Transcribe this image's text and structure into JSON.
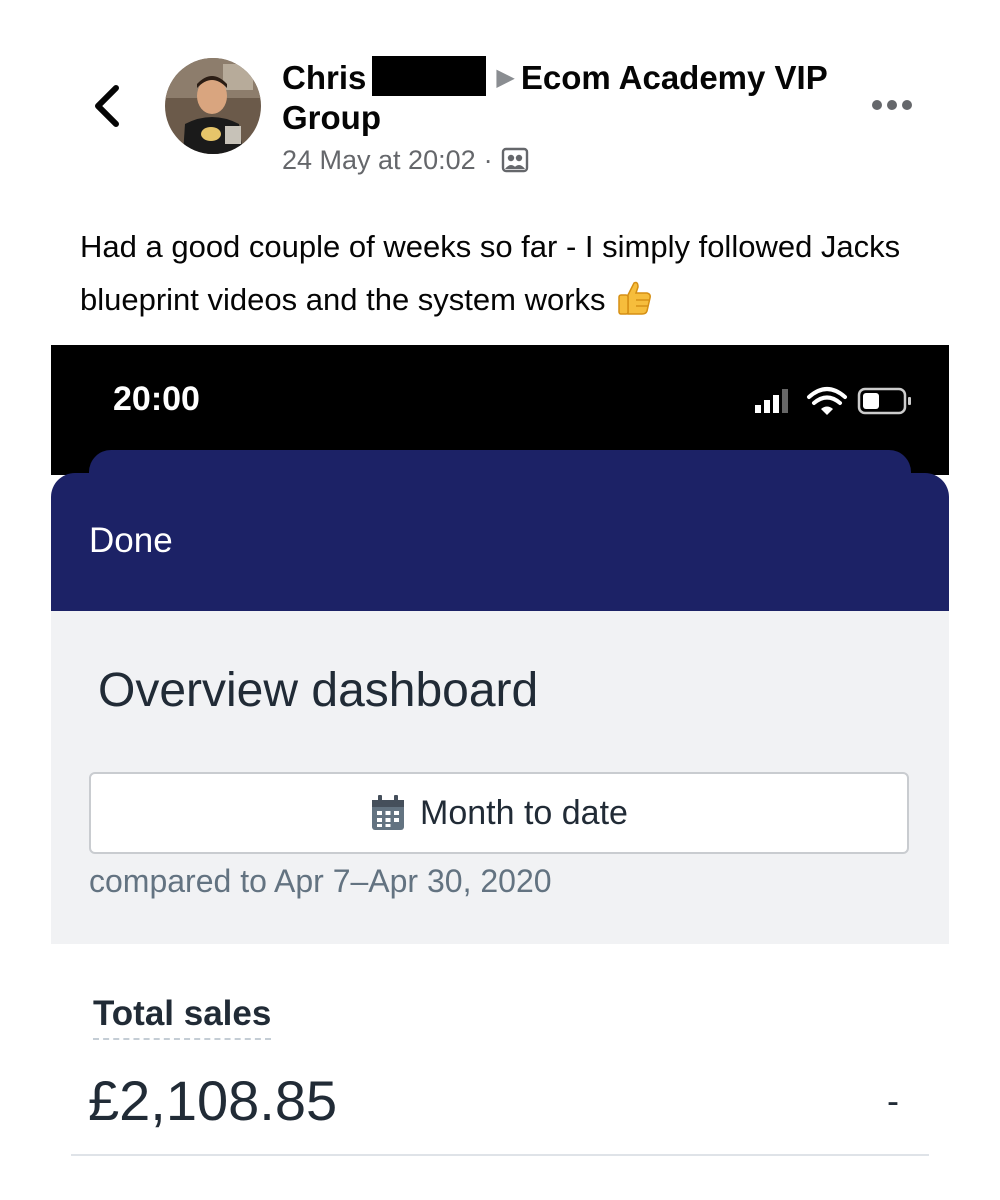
{
  "post": {
    "author": "Chris",
    "group": "Ecom Academy VIP Group",
    "timestamp": "24 May at 20:02",
    "separator": "·",
    "text": "Had a good couple of weeks so far - I simply followed Jacks blueprint videos and the system works",
    "icons": {
      "back": "chevron-left-icon",
      "audience": "group-audience-icon",
      "more": "more-options-icon",
      "emoji": "thumbs-up-emoji"
    }
  },
  "screenshot": {
    "status_bar": {
      "time": "20:00",
      "icons": [
        "cellular-signal-icon",
        "wifi-icon",
        "battery-icon"
      ]
    },
    "nav": {
      "done_label": "Done"
    },
    "dashboard": {
      "title": "Overview dashboard",
      "date_range_label": "Month to date",
      "date_icon": "calendar-icon",
      "compare_text": "compared to Apr 7–Apr 30, 2020"
    },
    "total_sales": {
      "label": "Total sales",
      "value": "£2,108.85",
      "change": "-"
    },
    "colors": {
      "nav_background": "#1c2266",
      "dashboard_background": "#f1f2f4"
    }
  }
}
